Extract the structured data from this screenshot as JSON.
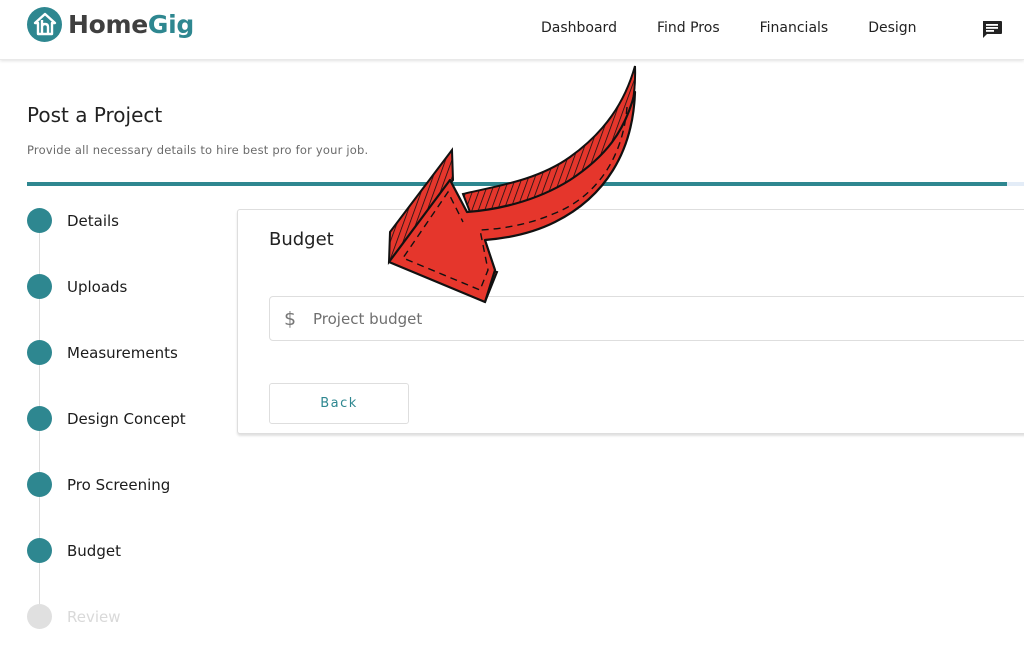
{
  "app": {
    "brand_part1": "Home",
    "brand_part2": "Gig",
    "brand_color": "#2e8790"
  },
  "nav": {
    "items": [
      {
        "label": "Dashboard"
      },
      {
        "label": "Find Pros"
      },
      {
        "label": "Financials"
      },
      {
        "label": "Design"
      }
    ],
    "chat_icon": "chat-message-icon"
  },
  "page": {
    "title": "Post a Project",
    "subtitle": "Provide all necessary details to hire best pro for your job.",
    "progress_percent": 97
  },
  "stepper": {
    "steps": [
      {
        "label": "Details",
        "status": "complete"
      },
      {
        "label": "Uploads",
        "status": "complete"
      },
      {
        "label": "Measurements",
        "status": "complete"
      },
      {
        "label": "Design Concept",
        "status": "complete"
      },
      {
        "label": "Pro Screening",
        "status": "complete"
      },
      {
        "label": "Budget",
        "status": "current"
      },
      {
        "label": "Review",
        "status": "pending"
      }
    ]
  },
  "budget_card": {
    "title": "Budget",
    "input_icon": "dollar-icon",
    "input_icon_glyph": "$",
    "input_placeholder": "Project budget",
    "input_value": "",
    "back_label": "Back"
  },
  "overlay": {
    "annotation": "red-arrow-pointing-at-budget-input",
    "arrow_color": "#e5362c"
  }
}
